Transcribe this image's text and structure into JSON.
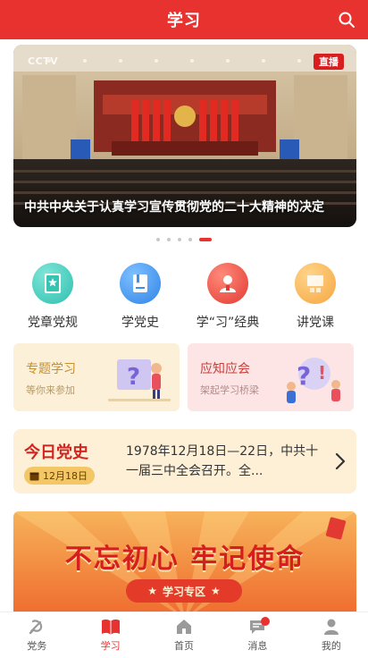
{
  "header": {
    "title": "学习"
  },
  "banner": {
    "channel_logo": "CCTV",
    "live_badge": "直播",
    "caption": "中共中央关于认真学习宣传贯彻党的二十大精神的决定",
    "slide_count": 5,
    "active_slide": 5
  },
  "quick_nav": [
    {
      "label": "党章党规",
      "icon": "book-star-icon",
      "color": "#3cc7b8"
    },
    {
      "label": "学党史",
      "icon": "book-icon",
      "color": "#3b8fe8"
    },
    {
      "label": "学“习”经典",
      "icon": "speaker-person-icon",
      "color": "#e8403a"
    },
    {
      "label": "讲党课",
      "icon": "classroom-icon",
      "color": "#f5a640"
    }
  ],
  "cards": [
    {
      "title": "专题学习",
      "subtitle": "等你来参加",
      "title_color": "#c8902a",
      "bg": "#fdf0d8"
    },
    {
      "title": "应知应会",
      "subtitle": "架起学习桥梁",
      "title_color": "#c93f3a",
      "bg": "#fde5e5"
    }
  ],
  "today_history": {
    "title": "今日党史",
    "date": "12月18日",
    "text": "1978年12月18日—22日，中共十一届三中全会召开。全..."
  },
  "slogan_banner": {
    "slogan": "不忘初心 牢记使命",
    "button_label": "学习专区"
  },
  "tabbar": [
    {
      "label": "党务",
      "icon": "party-emblem-icon",
      "active": false
    },
    {
      "label": "学习",
      "icon": "open-book-icon",
      "active": true
    },
    {
      "label": "首页",
      "icon": "home-icon",
      "active": false
    },
    {
      "label": "消息",
      "icon": "message-icon",
      "active": false,
      "badge": true
    },
    {
      "label": "我的",
      "icon": "user-icon",
      "active": false
    }
  ],
  "colors": {
    "primary": "#e8322f",
    "accent": "#f3c766"
  }
}
